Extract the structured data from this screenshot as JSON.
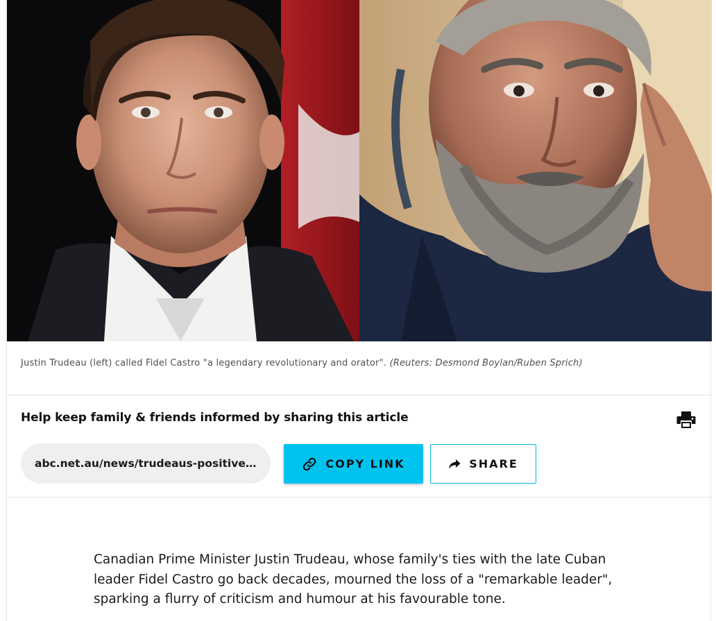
{
  "hero": {
    "left_photo_subject": "Justin Trudeau",
    "right_photo_subject": "Fidel Castro"
  },
  "caption": {
    "text": "Justin Trudeau (left) called Fidel Castro \"a legendary revolutionary and orator\".",
    "credit": "(Reuters: Desmond Boylan/Ruben Sprich)"
  },
  "share": {
    "heading": "Help keep family & friends informed by sharing this article",
    "url": "abc.net.au/news/trudeaus-positive-comments-about-castro-spark-criticism",
    "copy_label": "COPY LINK",
    "share_label": "SHARE",
    "print_icon": "print-icon",
    "link_icon": "link-icon",
    "share_icon": "share-arrow-icon"
  },
  "article": {
    "paragraph_1": "Canadian Prime Minister Justin Trudeau, whose family's ties with the late Cuban leader Fidel Castro go back decades, mourned the loss of a \"remarkable leader\", sparking a flurry of criticism and humour at his favourable tone."
  },
  "colors": {
    "accent": "#00c2ef",
    "accent_border": "#00b4e0",
    "url_field_bg": "#efefef",
    "caption_text": "#505050"
  }
}
